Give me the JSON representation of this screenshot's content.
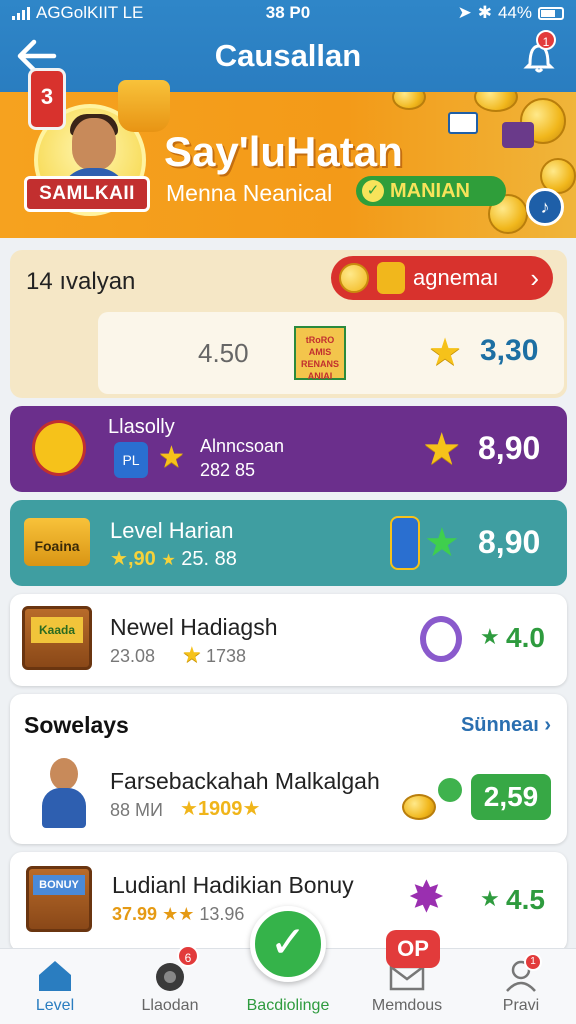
{
  "status": {
    "carrier": "AGGolKIIT  LE",
    "time": "38 P0",
    "battery": "44%"
  },
  "header": {
    "title": "Causallan",
    "notification_count": "1"
  },
  "banner": {
    "ribbon": "SAMLKAII",
    "title": "Say'luHatan",
    "subtitle": "Menna Neanical",
    "pill": "MANIAN"
  },
  "card1": {
    "heading": "14 ıvalyan",
    "button_label": "agnemaı",
    "can_label": "3",
    "value_mid": "4.50",
    "value_right": "3,30",
    "board_lines": [
      "tRoRO",
      "AMIS",
      "RENANS",
      "ANIAI"
    ]
  },
  "card2": {
    "title": "Llasolly",
    "sub_title": "Alnncsoan",
    "sub_value": "282 85",
    "value": "8,90",
    "badge_text": "PL"
  },
  "card3": {
    "title": "Level Harian",
    "stat1": ",90",
    "stat2": "25. 88",
    "value": "8,90",
    "crate_label": "Foaina"
  },
  "card4": {
    "title": "Newel Hadiagsh",
    "stat1": "23.08",
    "stat2": "1738",
    "value": "4.0",
    "chest_label": "Kaada"
  },
  "section": {
    "title": "Sowelays",
    "see_all": "Sünneaı",
    "item_title": "Farsebackahah Malkalgah",
    "item_stat1": "88 MИ",
    "item_stat2": "1909",
    "item_value": "2,59"
  },
  "card6": {
    "title": "Ludianl Hadikian Bonuy",
    "stat1": "37.99",
    "stat2": "13.96",
    "value": "4.5",
    "chest_label": "BONUY"
  },
  "bottom_nav": {
    "items": [
      {
        "label": "Level"
      },
      {
        "label": "Llaodan",
        "badge": "6"
      },
      {
        "label": "Bacdiolinge"
      },
      {
        "label": "Memdous"
      },
      {
        "label": "Pravi",
        "badge": "1"
      }
    ],
    "op_badge": "OP",
    "active_color": "#2a7dc0"
  }
}
